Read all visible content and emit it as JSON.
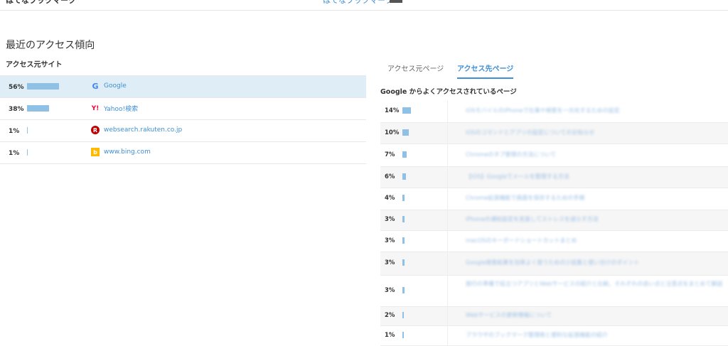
{
  "top": {
    "left_label": "はてなブックマーク",
    "link": "はてなブックマーク"
  },
  "section": {
    "title": "最近のアクセス傾向"
  },
  "sources": {
    "title": "アクセス元サイト",
    "rows": [
      {
        "pct": "56%",
        "value": 56,
        "name": "Google",
        "icon": "google-icon",
        "icon_glyph": "G"
      },
      {
        "pct": "38%",
        "value": 38,
        "name": "Yahoo!検索",
        "icon": "yahoo-icon",
        "icon_glyph": "Y!"
      },
      {
        "pct": "1%",
        "value": 1,
        "name": "websearch.rakuten.co.jp",
        "icon": "rakuten-icon",
        "icon_glyph": "R"
      },
      {
        "pct": "1%",
        "value": 1,
        "name": "www.bing.com",
        "icon": "bing-icon",
        "icon_glyph": "b"
      }
    ]
  },
  "tabs": [
    {
      "label": "アクセス元ページ",
      "active": false
    },
    {
      "label": "アクセス先ページ",
      "active": true
    }
  ],
  "destinations": {
    "title": "Google からよくアクセスされているページ",
    "rows": [
      {
        "pct": "14%",
        "value": 14,
        "title": "iOSモバイルのiPhoneで仕事や検索を一元化するための設定"
      },
      {
        "pct": "10%",
        "value": 10,
        "title": "iOSのコマンドとアプリの設定についてのお知らせ"
      },
      {
        "pct": "7%",
        "value": 7,
        "title": "Chromeのタブ管理の方法について"
      },
      {
        "pct": "6%",
        "value": 6,
        "title": "【iOS】Googleでメールを整理する方法"
      },
      {
        "pct": "4%",
        "value": 4,
        "title": "Chrome拡張機能で画面を保存するための手順"
      },
      {
        "pct": "3%",
        "value": 3,
        "title": "iPhoneの通知設定を見直してストレスを減らす方法"
      },
      {
        "pct": "3%",
        "value": 3,
        "title": "macOSのキーボードショートカットまとめ"
      },
      {
        "pct": "3%",
        "value": 3,
        "title": "Google検索結果を効率よく使うための小技集と使い分けのポイント"
      },
      {
        "pct": "3%",
        "value": 3,
        "title": "旅行の準備で役立つアプリとWebサービスの紹介と比較、それぞれの良い点と注意点をまとめて解説"
      },
      {
        "pct": "2%",
        "value": 2,
        "title": "Webサービスの更新情報について"
      },
      {
        "pct": "1%",
        "value": 1,
        "title": "ブラウザのブックマーク整理術と便利な拡張機能の紹介"
      }
    ]
  }
}
